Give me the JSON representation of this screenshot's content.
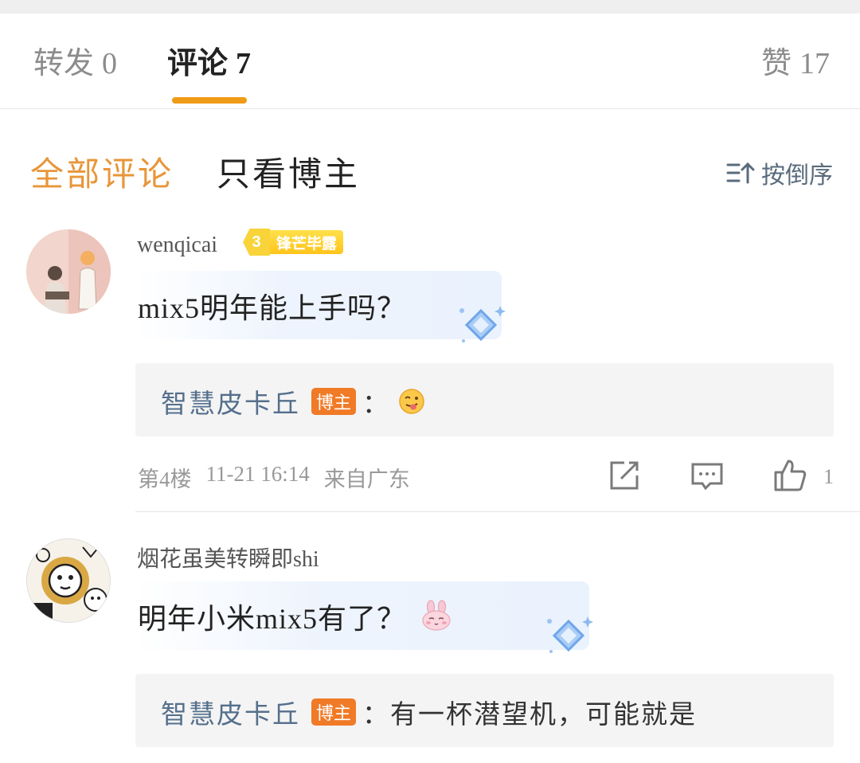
{
  "tabs": {
    "repost_label": "转发",
    "repost_count": "0",
    "comments_label": "评论",
    "comments_count": "7",
    "likes_label": "赞",
    "likes_count": "17"
  },
  "filter": {
    "all_label": "全部评论",
    "owner_only_label": "只看博主",
    "sort_label": "按倒序"
  },
  "comments": [
    {
      "username": "wenqicai",
      "level": "3",
      "level_name": "锋芒毕露",
      "text": "mix5明年能上手吗？",
      "reply": {
        "name": "智慧皮卡丘",
        "tag": "博主",
        "separator": "：",
        "text": ""
      },
      "floor": "第4楼",
      "time": "11-21 16:14",
      "location": "来自广东",
      "like_count": "1"
    },
    {
      "username": "烟花虽美转瞬即shi",
      "text": "明年小米mix5有了？",
      "reply": {
        "name": "智慧皮卡丘",
        "tag": "博主",
        "separator": "：",
        "text": "有一杯潜望机，可能就是"
      }
    }
  ],
  "icons": {
    "share": "share-icon",
    "comment": "comment-icon",
    "like": "thumbs-up-icon",
    "sort": "sort-icon"
  },
  "colors": {
    "accent_orange": "#f09b17",
    "owner_tag": "#f07a26",
    "reply_name": "#556f8c"
  }
}
